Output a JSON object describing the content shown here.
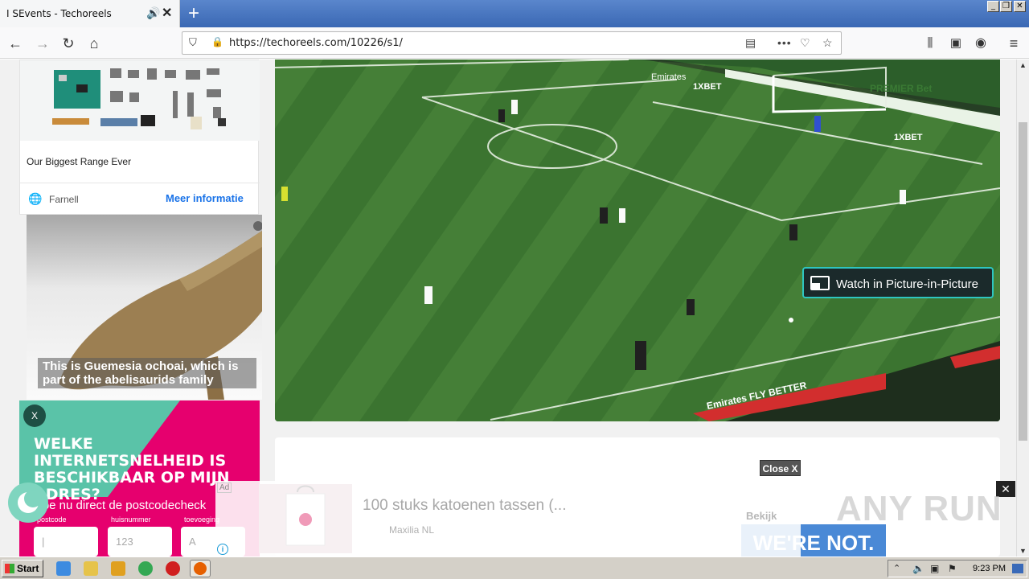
{
  "browser": {
    "tab_title": "I SEvents - Techoreels",
    "speaker_icon": "🔊",
    "close_tab": "✕",
    "new_tab": "+",
    "url": "https://techoreels.com/10226/s1/",
    "window_controls": [
      "_",
      "❐",
      "✕"
    ]
  },
  "ad_farnell": {
    "headline": "Our Biggest Range Ever",
    "advertiser": "Farnell",
    "cta": "Meer informatie"
  },
  "dino_ad": {
    "caption": "This is Guemesia ochoai, which is part of the abelisaurids family"
  },
  "welke_ad": {
    "close": "X",
    "headline": "WELKE INTERNETSNELHEID IS BESCHIKBAAR OP MIJN ADRES?",
    "sub": "Doe nu direct de postcodecheck",
    "fields": [
      {
        "label": "postcode",
        "placeholder": "|"
      },
      {
        "label": "huisnummer",
        "placeholder": "123"
      },
      {
        "label": "toevoeging",
        "placeholder": "A"
      }
    ]
  },
  "video": {
    "pip_label": "Watch in Picture-in-Picture",
    "board_texts": [
      "Emirates",
      "1XBET",
      "1XBET",
      "PREMIER Bet",
      "Emirates FLY BETTER"
    ]
  },
  "close_button": "Close X",
  "sticky_ad": {
    "ad_tag": "Ad",
    "title": "100 stuks katoenen tassen (...",
    "advertiser": "Maxilia NL",
    "cta": "Bekijk",
    "info": "i",
    "close": "✕"
  },
  "watermark": "ANY RUN",
  "banner_fragment": "WE'RE NOT.",
  "taskbar": {
    "start": "Start",
    "clock": "9:23 PM"
  }
}
